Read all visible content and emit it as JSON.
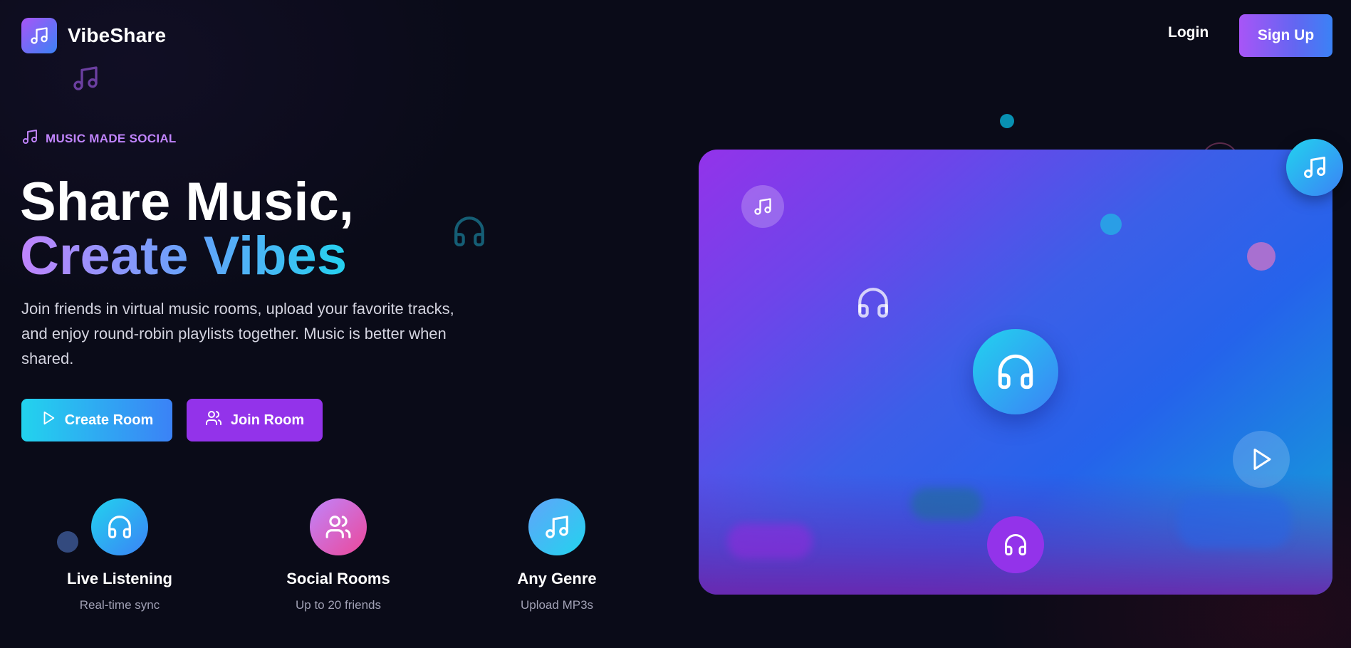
{
  "header": {
    "brand": "VibeShare",
    "login_label": "Login",
    "signup_label": "Sign Up"
  },
  "hero": {
    "tagline": "MUSIC MADE SOCIAL",
    "headline_line1": "Share Music,",
    "headline_line2": "Create Vibes",
    "description": "Join friends in virtual music rooms, upload your favorite tracks, and enjoy round-robin playlists together. Music is better when shared.",
    "create_room_label": "Create Room",
    "join_room_label": "Join Room"
  },
  "features": [
    {
      "title": "Live Listening",
      "subtitle": "Real-time sync",
      "icon": "headphones-icon"
    },
    {
      "title": "Social Rooms",
      "subtitle": "Up to 20 friends",
      "icon": "users-icon"
    },
    {
      "title": "Any Genre",
      "subtitle": "Upload MP3s",
      "icon": "music-note-icon"
    }
  ],
  "colors": {
    "accent_purple": "#a855f7",
    "accent_blue": "#3b82f6",
    "accent_cyan": "#22d3ee",
    "join_purple": "#9333ea",
    "tagline": "#c084fc",
    "background": "#0a0b18"
  }
}
